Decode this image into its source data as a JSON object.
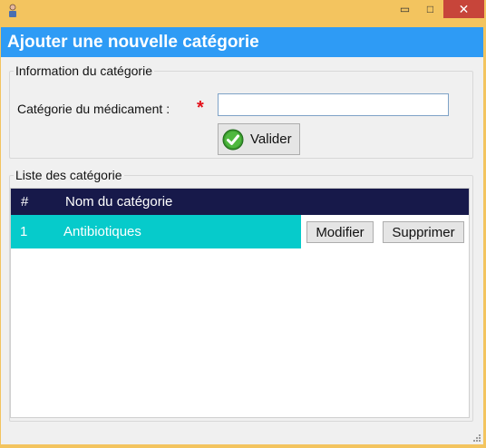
{
  "window": {
    "minimize_glyph": "▭",
    "maximize_glyph": "□",
    "close_glyph": "✕"
  },
  "header": {
    "title": "Ajouter une nouvelle catégorie"
  },
  "info_group": {
    "legend": "Information du catégorie",
    "field_label": "Catégorie du médicament :",
    "required_mark": "*",
    "input_value": "",
    "validate_label": "Valider"
  },
  "list_group": {
    "legend": "Liste des catégorie",
    "columns": [
      "#",
      "Nom du catégorie"
    ],
    "rows": [
      {
        "num": "1",
        "name": "Antibiotiques",
        "modify_label": "Modifier",
        "delete_label": "Supprimer"
      }
    ]
  },
  "colors": {
    "header_bg": "#2e9bf5",
    "grid_head_bg": "#17194a",
    "selected_row_bg": "#06cbcb",
    "window_frame": "#f3c45f",
    "close_button": "#c7453a",
    "required": "#e4101a"
  },
  "icons": [
    "app-icon",
    "minimize-icon",
    "maximize-icon",
    "close-icon",
    "check-icon",
    "resize-grip-icon"
  ]
}
